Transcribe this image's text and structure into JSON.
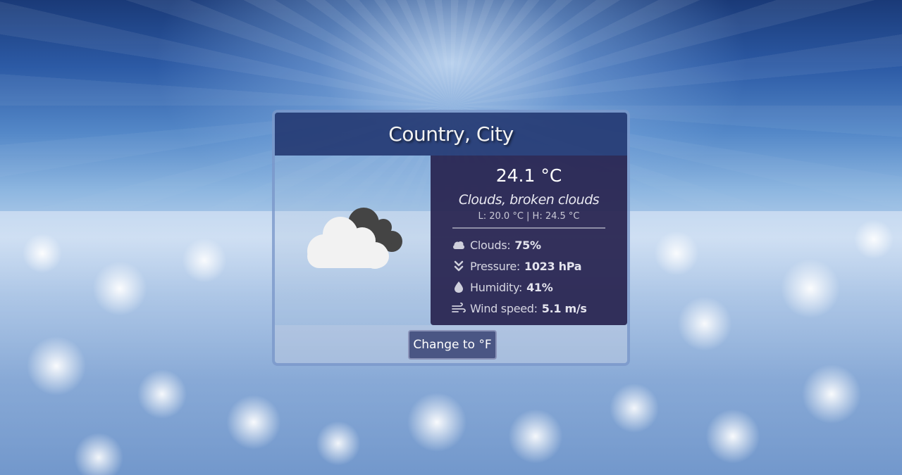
{
  "location": {
    "title": "Country, City"
  },
  "weather": {
    "icon": "cloudy-icon",
    "temperature": "24.1 °C",
    "description": "Clouds, broken clouds",
    "range": "L: 20.0 °C | H: 24.5 °C"
  },
  "stats": [
    {
      "icon": "cloud-icon",
      "label": "Clouds:",
      "value": "75%"
    },
    {
      "icon": "double-chevron-down-icon",
      "label": "Pressure:",
      "value": "1023 hPa"
    },
    {
      "icon": "droplet-icon",
      "label": "Humidity:",
      "value": "41%"
    },
    {
      "icon": "wind-icon",
      "label": "Wind speed:",
      "value": "5.1 m/s"
    }
  ],
  "actions": {
    "toggle_unit_label": "Change to °F"
  },
  "colors": {
    "header_bg": "#20346e",
    "details_bg": "#282450",
    "button_bg": "#4a5684",
    "cloud_front": "#f2f2f2",
    "cloud_back": "#444444"
  }
}
